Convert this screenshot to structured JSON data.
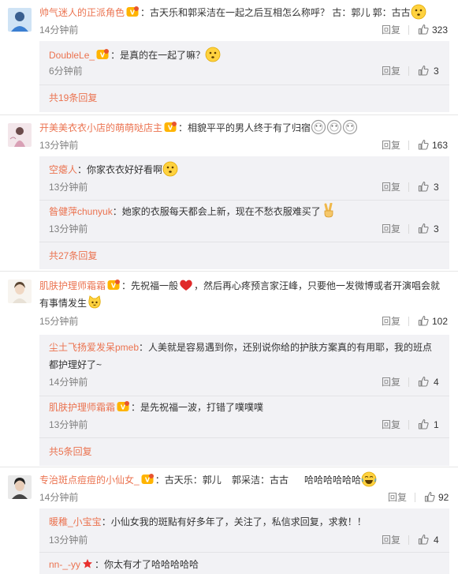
{
  "labels": {
    "reply": "回复"
  },
  "colors": {
    "name": "#eb7350",
    "meta": "#808080",
    "reply_bg": "#f2f2f5"
  },
  "comments": [
    {
      "name": "帅气迷人的正派角色",
      "text": "：古天乐和郭采洁在一起之后互相怎么称呼？ 古：郭儿 郭：古古",
      "time": "14分钟前",
      "likes": "323",
      "replies": [
        {
          "name": "DoubleLe_",
          "text": "：是真的在一起了嘛？",
          "time": "6分钟前",
          "likes": "3"
        }
      ],
      "more": "共19条回复"
    },
    {
      "name": "开美美衣衣小店的萌萌哒店主",
      "text": "：相貌平平的男人终于有了归宿",
      "time": "13分钟前",
      "likes": "163",
      "replies": [
        {
          "name": "空瘪人",
          "text": "：你家衣衣好好看啊",
          "time": "13分钟前",
          "likes": "3"
        },
        {
          "name": "昝健萍chunyuk",
          "text": "：她家的衣服每天都会上新，现在不愁衣服难买了",
          "time": "13分钟前",
          "likes": "3"
        }
      ],
      "more": "共27条回复"
    },
    {
      "name": "肌肤护理师霜霜",
      "text": "：先祝福一般",
      "text2": "，然后再心疼预言家汪峰，只要他一发微博或者开演唱会就",
      "text3": "有事情发生",
      "time": "15分钟前",
      "likes": "102",
      "replies": [
        {
          "name": "尘土飞扬爱发呆pmeb",
          "text": "：人美就是容易遇到你，还别说你给的护肤方案真的有用耶，我的班点都护理好了~",
          "time": "14分钟前",
          "likes": "4"
        },
        {
          "name": "肌肤护理师霜霜",
          "text": "：是先祝福一波，打错了噗噗噗",
          "time": "13分钟前",
          "likes": "1"
        }
      ],
      "more": "共5条回复"
    },
    {
      "name": "专治斑点痘痘的小仙女_",
      "text": "：古天乐：郭儿    郭采洁：古古      哈哈哈哈哈哈",
      "time": "14分钟前",
      "likes": "92",
      "replies": [
        {
          "name": "暖稚_小宝宝",
          "text": "：小仙女我的斑點有好多年了，关注了，私信求回复，求救！！",
          "time": "13分钟前",
          "likes": "4"
        },
        {
          "name": "nn-_-yy",
          "text": "：你太有才了哈哈哈哈哈",
          "time": "",
          "likes": ""
        }
      ],
      "more": ""
    }
  ]
}
